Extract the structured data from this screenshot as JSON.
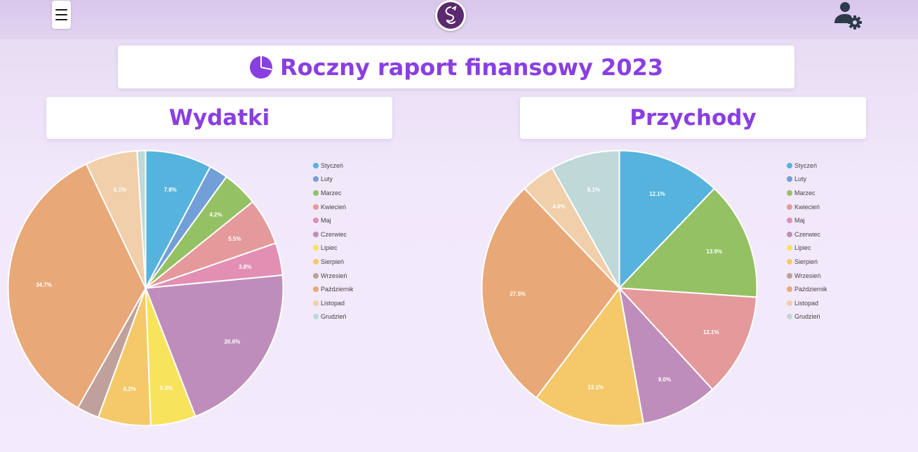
{
  "header": {
    "title": "Roczny raport finansowy 2023",
    "icons": {
      "menu": "hamburger-menu-icon",
      "logo": "dragon-logo-icon",
      "user_settings": "user-gear-icon",
      "title": "pie-chart-icon"
    }
  },
  "colors": {
    "accent": "#8a3fe0",
    "months": [
      "#55b3dd",
      "#729fd7",
      "#94c163",
      "#e49a9a",
      "#e28fb3",
      "#bf8dbb",
      "#f8e35d",
      "#f5c96a",
      "#bfa09a",
      "#e9a878",
      "#f1cfaa",
      "#bfd8d8"
    ]
  },
  "legend": {
    "months": [
      "Styczeń",
      "Luty",
      "Marzec",
      "Kwiecień",
      "Maj",
      "Czerwiec",
      "Lipiec",
      "Sierpień",
      "Wrzesień",
      "Październik",
      "Listopad",
      "Grudzień"
    ]
  },
  "chart_data": [
    {
      "type": "pie",
      "title": "Wydatki",
      "categories": [
        "Styczeń",
        "Luty",
        "Marzec",
        "Kwiecień",
        "Maj",
        "Czerwiec",
        "Lipiec",
        "Sierpień",
        "Wrzesień",
        "Październik",
        "Listopad",
        "Grudzień"
      ],
      "values": [
        7.8,
        2.2,
        4.2,
        5.5,
        3.8,
        20.6,
        5.3,
        6.2,
        2.6,
        34.7,
        6.1,
        1.0
      ],
      "labels": [
        "7.8%",
        "",
        "4.2%",
        "5.5%",
        "3.8%",
        "20.6%",
        "5.3%",
        "6.2%",
        "",
        "34.7%",
        "6.1%",
        ""
      ],
      "legend_position": "right"
    },
    {
      "type": "pie",
      "title": "Przychody",
      "categories": [
        "Styczeń",
        "Luty",
        "Marzec",
        "Kwiecień",
        "Maj",
        "Czerwiec",
        "Lipiec",
        "Sierpień",
        "Wrzesień",
        "Październik",
        "Listopad",
        "Grudzień"
      ],
      "values": [
        12.1,
        0,
        13.9,
        12.1,
        0,
        9.0,
        0,
        13.1,
        0,
        27.5,
        4.0,
        8.1
      ],
      "labels": [
        "12.1%",
        "",
        "13.9%",
        "12.1%",
        "",
        "9.0%",
        "",
        "13.1%",
        "",
        "27.5%",
        "4.0%",
        "8.1%"
      ],
      "legend_position": "right"
    }
  ]
}
